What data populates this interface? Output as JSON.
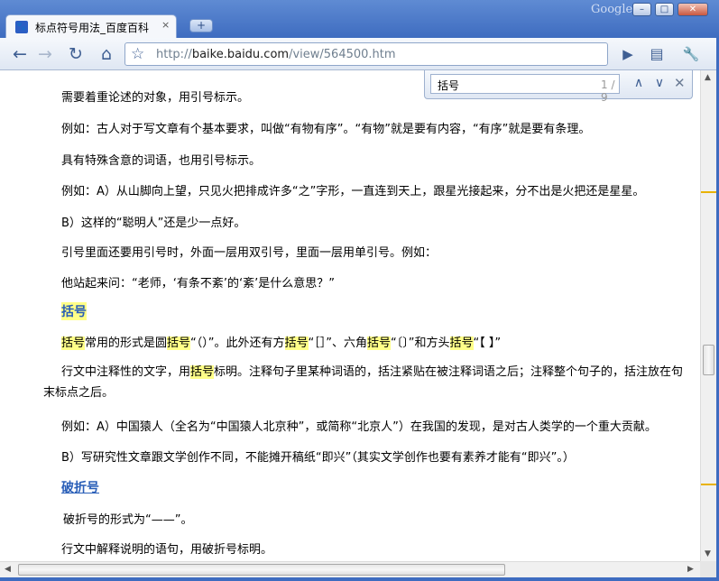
{
  "window": {
    "brand": "Google",
    "minimize": "–",
    "maximize": "□",
    "close": "✕"
  },
  "tab": {
    "title": "标点符号用法_百度百科",
    "close": "×",
    "newtab": "+"
  },
  "toolbar": {
    "back": "←",
    "forward": "→",
    "reload": "↻",
    "home": "⌂",
    "url_scheme": "http://",
    "url_host": "baike.baidu.com",
    "url_path": "/view/564500.htm",
    "go": "▶",
    "page_menu": "▤",
    "wrench_menu": "🔧"
  },
  "findbar": {
    "query": "括号",
    "count": "1 / 9",
    "prev": "∧",
    "next": "∨",
    "close": "✕"
  },
  "content": {
    "p1": "需要着重论述的对象，用引号标示。",
    "p2": "例如：古人对于写文章有个基本要求，叫做“有物有序”。“有物”就是要有内容，“有序”就是要有条理。",
    "p3": "具有特殊含意的词语，也用引号标示。",
    "p4": "例如：A）从山脚向上望，只见火把排成许多“之”字形，一直连到天上，跟星光接起来，分不出是火把还是星星。",
    "p5": "B）这样的“聪明人”还是少一点好。",
    "p6": "引号里面还要用引号时，外面一层用双引号，里面一层用单引号。例如：",
    "p7": "他站起来问：“老师，‘有条不紊’的‘紊’是什么意思？”",
    "heading1": "括号",
    "p8_a": "括号",
    "p8_b": "常用的形式是圆",
    "p8_c": "括号",
    "p8_d": "“（）”。此外还有方",
    "p8_e": "括号",
    "p8_f": "“［］”、六角",
    "p8_g": "括号",
    "p8_h": "“〔〕”和方头",
    "p8_i": "括号",
    "p8_j": "“【 】”",
    "p9_a": "行文中注释性的文字，用",
    "p9_b": "括号",
    "p9_c": "标明。注释句子里某种词语的，括注紧贴在被注释词语之后；注释整个句子的，括注放在句末标点之后。",
    "p10": "例如：A）中国猿人（全名为“中国猿人北京种”，或简称“北京人”）在我国的发现，是对古人类学的一个重大贡献。",
    "p11": "B）写研究性文章跟文学创作不同，不能摊开稿纸“即兴”（其实文学创作也要有素养才能有“即兴”。）",
    "heading2": "破折号",
    "p12": "破折号的形式为“——”。",
    "p13": "行文中解释说明的语句，用破折号标明。"
  },
  "colors": {
    "frame": "#3e6cc0",
    "highlight": "#ffff88",
    "link": "#2a5fb8",
    "scroll_marker": "#e8b200"
  }
}
